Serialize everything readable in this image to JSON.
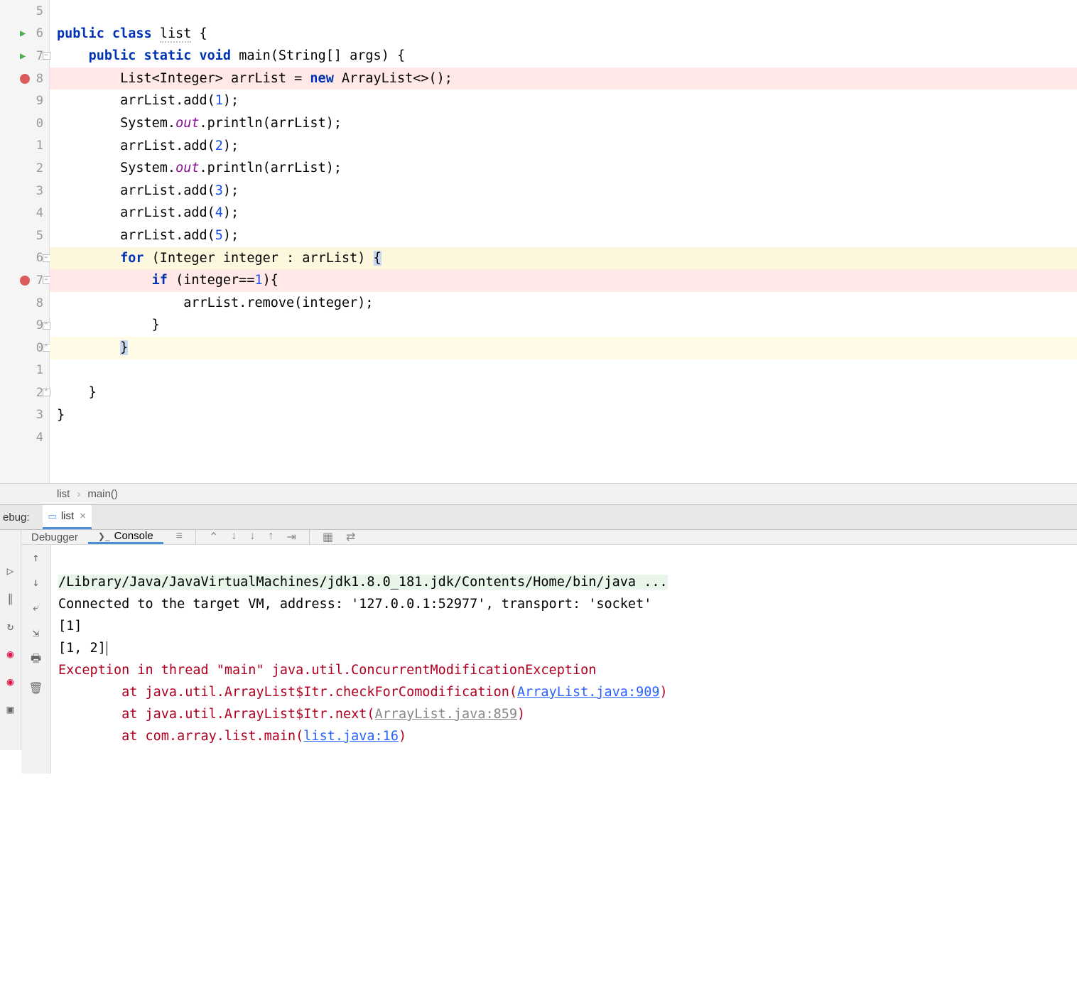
{
  "editor": {
    "line_numbers": [
      "5",
      "6",
      "7",
      "8",
      "9",
      "0",
      "1",
      "2",
      "3",
      "4",
      "5",
      "6",
      "7",
      "8",
      "9",
      "0",
      "1",
      "2",
      "3",
      "4"
    ],
    "code": {
      "l6": {
        "kw1": "public",
        "kw2": "class",
        "name": "list",
        "rest": " {"
      },
      "l7": {
        "kw1": "public",
        "kw2": "static",
        "kw3": "void",
        "name": "main",
        "params": "(String[] args) {"
      },
      "l8": {
        "text1": "List<Integer> arrList = ",
        "kw": "new",
        "text2": " ArrayList<>();"
      },
      "l9": {
        "text1": "arrList.add(",
        "num": "1",
        "text2": ");"
      },
      "l10": {
        "text1": "System.",
        "fld": "out",
        "text2": ".println(arrList);"
      },
      "l11": {
        "text1": "arrList.add(",
        "num": "2",
        "text2": ");"
      },
      "l12": {
        "text1": "System.",
        "fld": "out",
        "text2": ".println(arrList);"
      },
      "l13": {
        "text1": "arrList.add(",
        "num": "3",
        "text2": ");"
      },
      "l14": {
        "text1": "arrList.add(",
        "num": "4",
        "text2": ");"
      },
      "l15": {
        "text1": "arrList.add(",
        "num": "5",
        "text2": ");"
      },
      "l16": {
        "kw": "for",
        "text1": " (Integer integer : arrList) ",
        "brace": "{"
      },
      "l17": {
        "kw": "if",
        "text1": " (integer==",
        "num": "1",
        "text2": "){"
      },
      "l18": {
        "text": "arrList.remove(integer);"
      },
      "l19": {
        "text": "}"
      },
      "l20": {
        "text": "}"
      },
      "l22": {
        "text": "}"
      },
      "l23": {
        "text": "}"
      }
    }
  },
  "breadcrumb": {
    "item1": "list",
    "item2": "main()"
  },
  "debug": {
    "label": "ebug:",
    "tab_name": "list",
    "subtabs": {
      "debugger": "Debugger",
      "console": "Console"
    },
    "console": {
      "cmd": "/Library/Java/JavaVirtualMachines/jdk1.8.0_181.jdk/Contents/Home/bin/java ...",
      "connected": "Connected to the target VM, address: '127.0.0.1:52977', transport: 'socket'",
      "out1": "[1]",
      "out2": "[1, 2]",
      "err_head": "Exception in thread \"main\" java.util.ConcurrentModificationException",
      "st1_a": "\tat java.util.ArrayList$Itr.checkForComodification(",
      "st1_link": "ArrayList.java:909",
      "st1_b": ")",
      "st2_a": "\tat java.util.ArrayList$Itr.next(",
      "st2_link": "ArrayList.java:859",
      "st2_b": ")",
      "st3_a": "\tat com.array.list.main(",
      "st3_link": "list.java:16",
      "st3_b": ")"
    }
  }
}
